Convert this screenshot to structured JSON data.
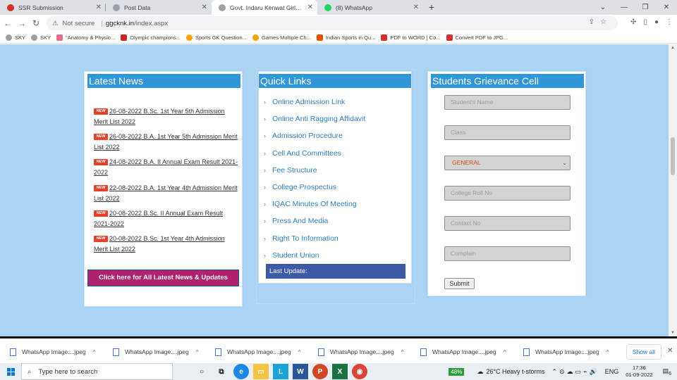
{
  "browser": {
    "tabs": [
      {
        "title": "SSR Submission",
        "icon_color": "#d93025"
      },
      {
        "title": "Post Data",
        "icon_color": "#5f6368"
      },
      {
        "title": "Govt. Indaru Kenwat Girls College",
        "icon_color": "#5f6368"
      },
      {
        "title": "(8) WhatsApp",
        "icon_color": "#25d366"
      }
    ],
    "new_tab": "+",
    "not_secure": "Not secure",
    "url_domain": "ggcknk.in",
    "url_path": "/index.aspx",
    "bookmarks": [
      {
        "label": "SKY",
        "color": "#5f6368"
      },
      {
        "label": "SKY",
        "color": "#5f6368"
      },
      {
        "label": "\"Anatomy & Physio...",
        "color": "#e46c8c"
      },
      {
        "label": "Olympic champions...",
        "color": "#c62828"
      },
      {
        "label": "Sports GK Question...",
        "color": "#f4a300"
      },
      {
        "label": "Games Multiple Ch...",
        "color": "#f4a300"
      },
      {
        "label": "Indian Sports in Qu...",
        "color": "#e65100"
      },
      {
        "label": "PDF to WORD | Co...",
        "color": "#d32f2f"
      },
      {
        "label": "Convert PDF to JPG...",
        "color": "#d32f2f"
      }
    ]
  },
  "news": {
    "title": "Latest News",
    "badge": "NEW",
    "items": [
      {
        "text": "26-08-2022  B.Sc. 1st Year 5th Admission Merit List 2022"
      },
      {
        "text": "26-08-2022  B.A. 1st Year 5th Admission Merit List 2022"
      },
      {
        "text": "24-08-2022  B.A. II Annual Exam Result 2021-2022"
      },
      {
        "text": "22-08-2022  B.A. 1st Year 4th Admission Merit List 2022"
      },
      {
        "text": "20-08-2022  B.Sc. II Annual Exam Result 2021-2022"
      },
      {
        "text": "20-08-2022  B.Sc. 1st Year 4th Admission Merit List 2022"
      }
    ],
    "button": "Click here for All Latest News & Updates"
  },
  "quick_links": {
    "title": "Quick Links",
    "items": [
      "Online Admission Link",
      "Online Anti Ragging Affidavit",
      "Admission Procedure",
      "Cell And Committees",
      "Fee Structure",
      "College Prospectus",
      "IQAC Minutes Of Meeting",
      "Press And Media",
      "Right To Information",
      "Student Union"
    ],
    "last_update": "Last Update:"
  },
  "grievance": {
    "title": "Students Grievance Cell",
    "student_name": "Student's Name",
    "class": "Class",
    "category": "GENERAL",
    "roll_no": "College Roll No",
    "contact": "Contact No",
    "complain": "Complain",
    "submit": "Submit"
  },
  "downloads": {
    "items": [
      "WhatsApp Image....jpeg",
      "WhatsApp Image....jpeg",
      "WhatsApp Image....jpeg",
      "WhatsApp Image....jpeg",
      "WhatsApp Image....jpeg",
      "WhatsApp Image....jpeg"
    ],
    "show_all": "Show all"
  },
  "taskbar": {
    "search_placeholder": "Type here to search",
    "battery": "48%",
    "weather": "26°C  Heavy t-storms",
    "lang": "ENG",
    "time": "17:36",
    "date": "01-09-2022",
    "notifications": "6"
  }
}
